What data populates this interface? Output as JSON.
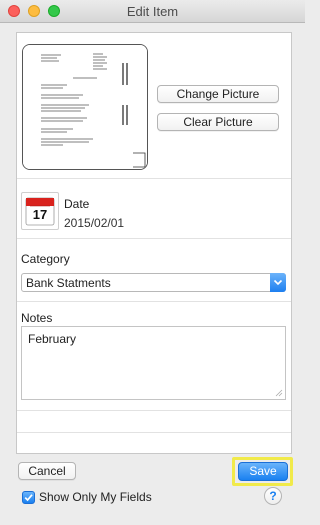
{
  "window": {
    "title": "Edit Item"
  },
  "picture": {
    "change_label": "Change Picture",
    "clear_label": "Clear Picture"
  },
  "date": {
    "label": "Date",
    "value": "2015/02/01",
    "icon_day": "17"
  },
  "category": {
    "label": "Category",
    "value": "Bank Statments"
  },
  "notes": {
    "label": "Notes",
    "value": "February"
  },
  "footer": {
    "cancel_label": "Cancel",
    "save_label": "Save",
    "show_only_label": "Show Only My Fields",
    "show_only_checked": true,
    "help_label": "?"
  },
  "colors": {
    "accent": "#1a80f0",
    "highlight": "#f1ea4a",
    "calendar_red": "#d9231e"
  }
}
